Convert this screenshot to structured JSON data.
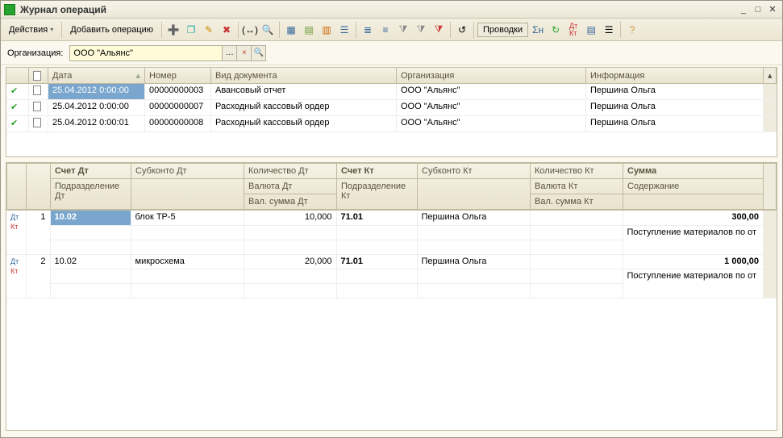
{
  "window": {
    "title": "Журнал операций"
  },
  "toolbar": {
    "actions_label": "Действия",
    "add_op_label": "Добавить операцию",
    "postings_label": "Проводки"
  },
  "filter": {
    "org_label": "Организация:",
    "org_value": "ООО \"Альянс\""
  },
  "grid1": {
    "cols": {
      "date": "Дата",
      "num": "Номер",
      "doc": "Вид документа",
      "org": "Организация",
      "info": "Информация"
    },
    "rows": [
      {
        "date": "25.04.2012 0:00:00",
        "num": "00000000003",
        "doc": "Авансовый отчет",
        "org": "ООО \"Альянс\"",
        "info": "Першина Ольга",
        "selected": true
      },
      {
        "date": "25.04.2012 0:00:00",
        "num": "00000000007",
        "doc": "Расходный кассовый ордер",
        "org": "ООО \"Альянс\"",
        "info": "Першина Ольга"
      },
      {
        "date": "25.04.2012 0:00:01",
        "num": "00000000008",
        "doc": "Расходный кассовый ордер",
        "org": "ООО \"Альянс\"",
        "info": "Першина Ольга"
      }
    ]
  },
  "grid2": {
    "cols": {
      "acc_dt": "Счет Дт",
      "subk_dt": "Субконто Дт",
      "qty_dt": "Количество Дт",
      "acc_kt": "Счет Кт",
      "subk_kt": "Субконто Кт",
      "qty_kt": "Количество Кт",
      "sum": "Сумма",
      "dept_dt": "Подразделение Дт",
      "curr_dt": "Валюта Дт",
      "dept_kt": "Подразделение Кт",
      "curr_kt": "Валюта Кт",
      "content": "Содержание",
      "csum_dt": "Вал. сумма Дт",
      "csum_kt": "Вал. сумма Кт"
    },
    "rows": [
      {
        "n": "1",
        "acc_dt": "10.02",
        "subk_dt": "блок ТР-5",
        "qty_dt": "10,000",
        "acc_kt": "71.01",
        "subk_kt": "Першина Ольга",
        "sum": "300,00",
        "content": "Поступление материалов по   от",
        "selected": true
      },
      {
        "n": "2",
        "acc_dt": "10.02",
        "subk_dt": "микросхема",
        "qty_dt": "20,000",
        "acc_kt": "71.01",
        "subk_kt": "Першина Ольга",
        "sum": "1 000,00",
        "content": "Поступление материалов по   от"
      }
    ]
  }
}
